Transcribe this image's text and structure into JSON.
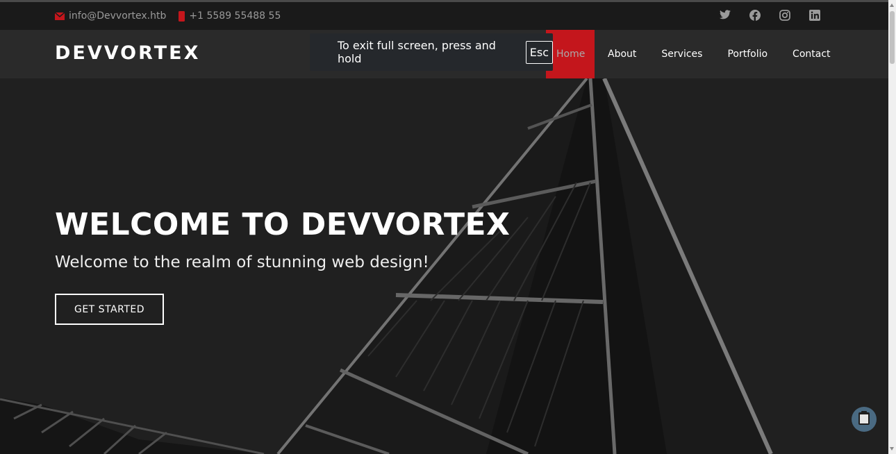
{
  "topbar": {
    "email": "info@Devvortex.htb",
    "phone": "+1 5589 55488 55",
    "social": [
      "twitter-icon",
      "facebook-icon",
      "instagram-icon",
      "linkedin-icon"
    ]
  },
  "header": {
    "logo": "DEVVORTEX",
    "nav": [
      "Home",
      "About",
      "Services",
      "Portfolio",
      "Contact"
    ],
    "active": "Home"
  },
  "fullscreen_notice": {
    "text": "To exit full screen, press and hold",
    "key": "Esc"
  },
  "hero": {
    "title": "WELCOME TO DEVVORTEX",
    "subtitle": "Welcome to the realm of stunning web design!",
    "button": "GET STARTED"
  },
  "colors": {
    "accent": "#c4161c",
    "header_bg": "#2a2a2a",
    "topbar_bg": "#1a1a1a"
  }
}
